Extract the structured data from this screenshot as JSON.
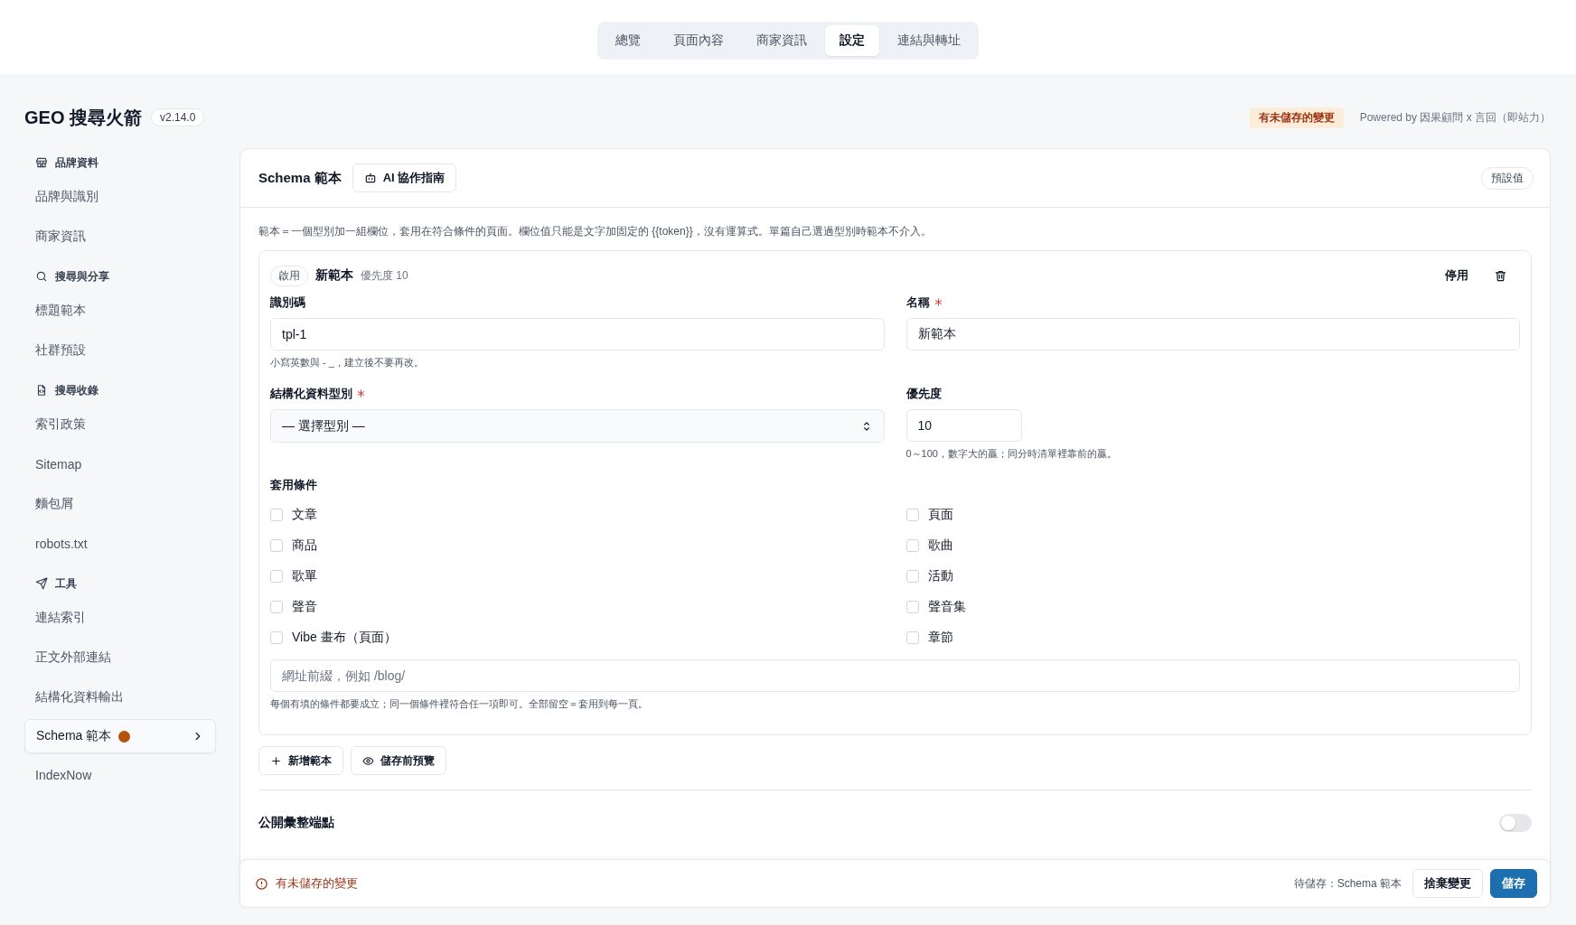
{
  "top_tabs": [
    {
      "label": "總覽",
      "selected": false
    },
    {
      "label": "頁面內容",
      "selected": false
    },
    {
      "label": "商家資訊",
      "selected": false
    },
    {
      "label": "設定",
      "selected": true
    },
    {
      "label": "連結與轉址",
      "selected": false
    }
  ],
  "app": {
    "title": "GEO 搜尋火箭",
    "version": "v2.14.0",
    "unsaved_badge": "有未儲存的變更",
    "powered_by": "Powered by 因果顧問 x 言回（即站力）"
  },
  "sidebar": {
    "sections": [
      {
        "heading": "品牌資料",
        "items": [
          {
            "label": "品牌與識別",
            "selected": false,
            "modified": false
          },
          {
            "label": "商家資訊",
            "selected": false,
            "modified": false
          }
        ]
      },
      {
        "heading": "搜尋與分享",
        "items": [
          {
            "label": "標題範本",
            "selected": false,
            "modified": false
          },
          {
            "label": "社群預設",
            "selected": false,
            "modified": false
          }
        ]
      },
      {
        "heading": "搜尋收錄",
        "items": [
          {
            "label": "索引政策",
            "selected": false,
            "modified": false
          },
          {
            "label": "Sitemap",
            "selected": false,
            "modified": false
          },
          {
            "label": "麵包屑",
            "selected": false,
            "modified": false
          },
          {
            "label": "robots.txt",
            "selected": false,
            "modified": false
          }
        ]
      },
      {
        "heading": "工具",
        "items": [
          {
            "label": "連結索引",
            "selected": false,
            "modified": false
          },
          {
            "label": "正文外部連結",
            "selected": false,
            "modified": false
          },
          {
            "label": "結構化資料輸出",
            "selected": false,
            "modified": false
          },
          {
            "label": "Schema 範本",
            "selected": true,
            "modified": true
          },
          {
            "label": "IndexNow",
            "selected": false,
            "modified": false
          }
        ]
      }
    ]
  },
  "panel": {
    "title": "Schema 範本",
    "guide_button": "AI 協作指南",
    "preset_button": "預設值",
    "description": "範本＝一個型別加一組欄位，套用在符合條件的頁面。欄位值只能是文字加固定的 {{token}}，沒有運算式。單篇自己選過型別時範本不介入。",
    "template": {
      "status_badge": "啟用",
      "name": "新範本",
      "priority_text": "優先度 10",
      "disable_button": "停用",
      "id_label": "識別碼",
      "id_value": "tpl-1",
      "id_hint": "小寫英數與 - _，建立後不要再改。",
      "name_label": "名稱",
      "name_required": true,
      "name_value": "新範本",
      "type_label": "結構化資料型別",
      "type_required": true,
      "type_value": "— 選擇型別 —",
      "priority_label": "優先度",
      "priority_value": "10",
      "priority_hint": "0～100，數字大的贏；同分時清單裡靠前的贏。",
      "conditions_label": "套用條件",
      "conditions": [
        {
          "label": "文章",
          "checked": false
        },
        {
          "label": "頁面",
          "checked": false
        },
        {
          "label": "商品",
          "checked": false
        },
        {
          "label": "歌曲",
          "checked": false
        },
        {
          "label": "歌單",
          "checked": false
        },
        {
          "label": "活動",
          "checked": false
        },
        {
          "label": "聲音",
          "checked": false
        },
        {
          "label": "聲音集",
          "checked": false
        },
        {
          "label": "Vibe 畫布（頁面）",
          "checked": false
        },
        {
          "label": "章節",
          "checked": false
        }
      ],
      "url_placeholder": "網址前綴，例如 /blog/",
      "conditions_hint": "每個有填的條件都要成立；同一個條件裡符合任一項即可。全部留空＝套用到每一頁。"
    },
    "add_button": "新增範本",
    "preview_button": "儲存前預覽",
    "endpoint": {
      "label": "公開彙整端點",
      "on": false
    }
  },
  "footer": {
    "warning": "有未儲存的變更",
    "pending": "待儲存：Schema 範本",
    "discard_button": "捨棄變更",
    "save_button": "儲存"
  }
}
